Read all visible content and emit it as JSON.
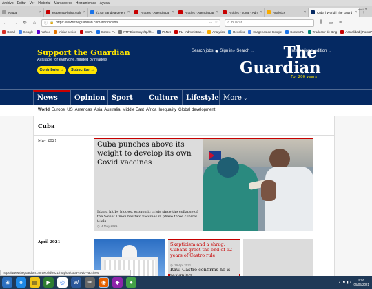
{
  "menubar": [
    "Archivo",
    "Editar",
    "Ver",
    "Historial",
    "Marcadores",
    "Herramientas",
    "Ayuda"
  ],
  "tabs": [
    {
      "label": "Nauta",
      "color": "#9a9a9a"
    },
    {
      "label": "es.prensa-latina.cu/index",
      "color": "#c70000"
    },
    {
      "label": "(373) Bandeja de entrada",
      "color": "#1a73e8"
    },
    {
      "label": "Articles - Agencia Latino",
      "color": "#c70000"
    },
    {
      "label": "Articles - Agencia Latino",
      "color": "#c70000"
    },
    {
      "label": "Articles - portal - Admin",
      "color": "#c70000"
    },
    {
      "label": "Analytics",
      "color": "#f9ab00"
    },
    {
      "label": "Cuba | World | The Guard",
      "color": "#052962",
      "active": true
    }
  ],
  "url": "https://www.theguardian.com/world/cuba",
  "search_placeholder": "Buscar",
  "bookmarks": [
    {
      "label": "Gmail",
      "color": "#d93025"
    },
    {
      "label": "Google",
      "color": "#4285f4"
    },
    {
      "label": "Yahoo",
      "color": "#6001d2"
    },
    {
      "label": "Iniciar sesión",
      "color": "#e37400"
    },
    {
      "label": "ESPL",
      "color": "#c70000"
    },
    {
      "label": "Correo PL",
      "color": "#1a73e8"
    },
    {
      "label": "FTP Directory /ftp//ft...",
      "color": "#777777"
    },
    {
      "label": "PLNet",
      "color": "#2b579a"
    },
    {
      "label": "PL - Administrac...",
      "color": "#c70000"
    },
    {
      "label": "Analytics",
      "color": "#f9ab00"
    },
    {
      "label": "Revolico",
      "color": "#1e88e5"
    },
    {
      "label": "Imagenes de Google",
      "color": "#4285f4"
    },
    {
      "label": "Correo PL",
      "color": "#1a73e8"
    },
    {
      "label": "Traductor de Bing",
      "color": "#008373"
    },
    {
      "label": "Actualidad | FotosPL",
      "color": "#c70000"
    }
  ],
  "header": {
    "support_title": "Support the Guardian",
    "support_sub": "Available for everyone, funded by readers",
    "contribute": "Contribute",
    "subscribe": "Subscribe",
    "search_jobs": "Search jobs",
    "sign_in": "Sign in",
    "search": "Search",
    "edition": "International edition",
    "logo_top": "The",
    "logo_bottom": "Guardian",
    "logo_tag": "For 200 years"
  },
  "pillars": [
    {
      "label": "News"
    },
    {
      "label": "Opinion"
    },
    {
      "label": "Sport"
    },
    {
      "label": "Culture"
    },
    {
      "label": "Lifestyle"
    },
    {
      "label": "More"
    }
  ],
  "subnav": [
    "World",
    "Europe",
    "US",
    "Americas",
    "Asia",
    "Australia",
    "Middle East",
    "Africa",
    "Inequality",
    "Global development"
  ],
  "section_title": "Cuba",
  "groups": [
    {
      "date": "May 2021",
      "headline": "Cuba punches above its weight to develop its own Covid vaccines",
      "standfirst": "Island hit by biggest economic crisis since the collapse of the Soviet Union has two vaccines in phase three clinical trials",
      "timestamp": "4 May 2021"
    },
    {
      "date": "April 2021",
      "headline": "Skepticism and a shrug: Cubans greet the end of 62 years of Castro rule",
      "timestamp": "19 Apr 2021",
      "headline2": "Raúl Castro confirms he is resigning"
    }
  ],
  "status_url": "https://www.theguardian.com/world/2021/may/04/cuba-covid-vaccines",
  "tray": {
    "time": "9:50",
    "date": "05/05/2021"
  },
  "colors": {
    "brand": "#052962",
    "accent_yellow": "#ffe500",
    "news_red": "#c70000"
  }
}
